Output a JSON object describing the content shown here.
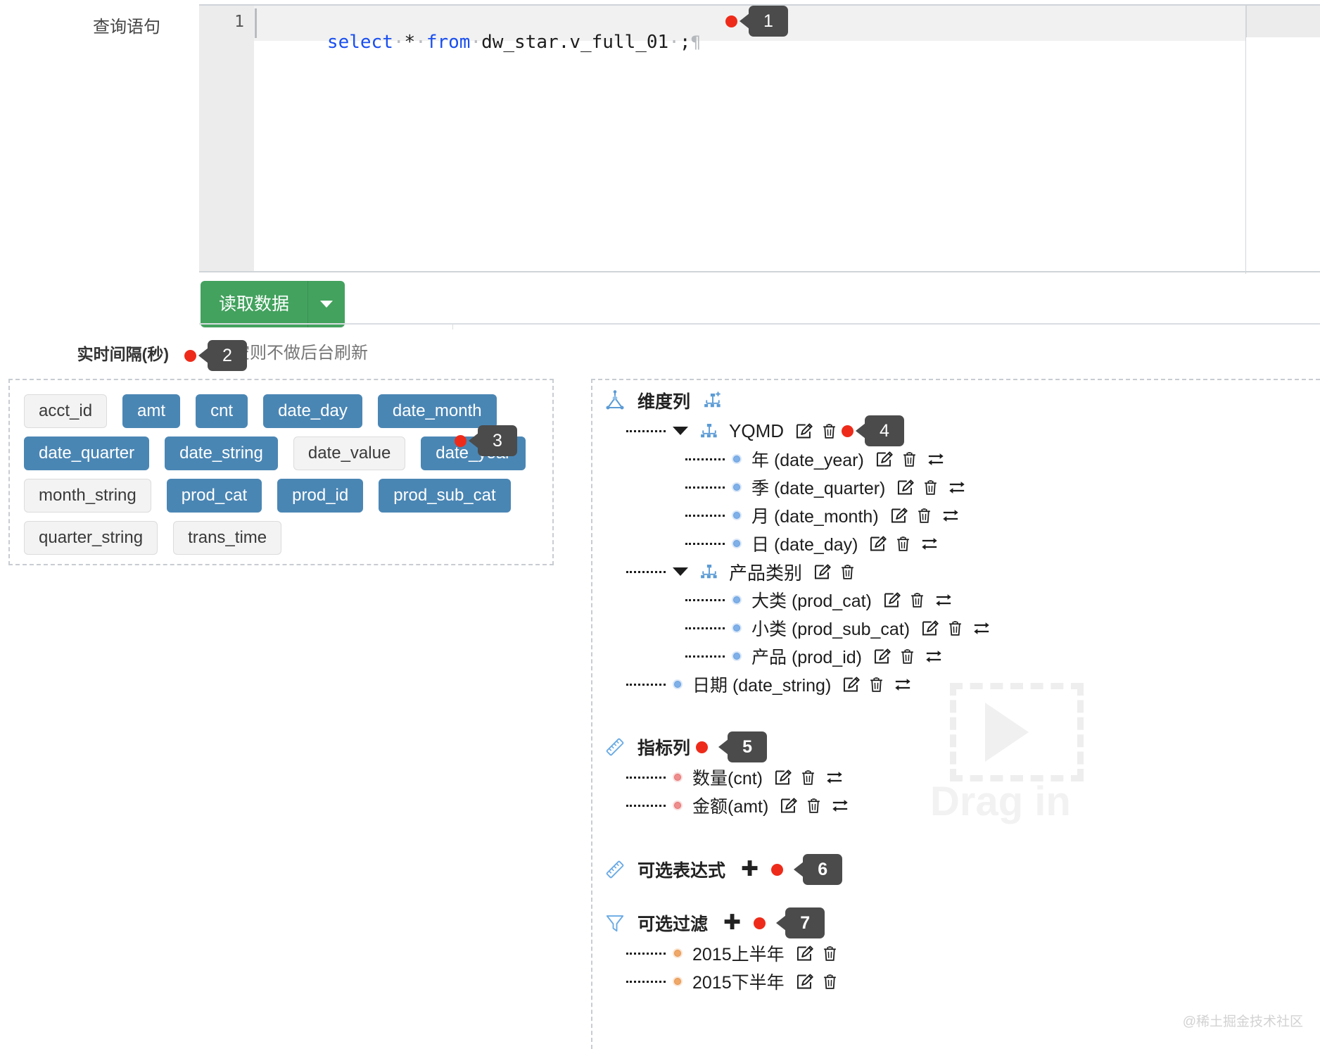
{
  "query": {
    "label": "查询语句",
    "line_number": "1",
    "sql_tokens": [
      {
        "t": "select",
        "k": "kw"
      },
      {
        "t": "·",
        "k": "sep"
      },
      {
        "t": "*",
        "k": "plain"
      },
      {
        "t": "·",
        "k": "sep"
      },
      {
        "t": "from",
        "k": "kw"
      },
      {
        "t": "·",
        "k": "sep"
      },
      {
        "t": "dw_star.v_full_01",
        "k": "plain"
      },
      {
        "t": "·",
        "k": "sep"
      },
      {
        "t": ";",
        "k": "plain"
      }
    ],
    "sql_text": "select * from dw_star.v_full_01 ;",
    "pilcrow": "¶",
    "callout": "1"
  },
  "actions": {
    "read_data_label": "读取数据",
    "dropdown_icon": "chevron-down-icon"
  },
  "realtime": {
    "label": "实时间隔(秒)",
    "placeholder": "留空则不做后台刷新",
    "value": "",
    "callout": "2"
  },
  "fields": {
    "callout": "3",
    "items": [
      {
        "name": "acct_id",
        "used": false
      },
      {
        "name": "amt",
        "used": true
      },
      {
        "name": "cnt",
        "used": true
      },
      {
        "name": "date_day",
        "used": true
      },
      {
        "name": "date_month",
        "used": true
      },
      {
        "name": "date_quarter",
        "used": true
      },
      {
        "name": "date_string",
        "used": true
      },
      {
        "name": "date_value",
        "used": false
      },
      {
        "name": "date_year",
        "used": true
      },
      {
        "name": "month_string",
        "used": false
      },
      {
        "name": "prod_cat",
        "used": true
      },
      {
        "name": "prod_id",
        "used": true
      },
      {
        "name": "prod_sub_cat",
        "used": true
      },
      {
        "name": "quarter_string",
        "used": false
      },
      {
        "name": "trans_time",
        "used": false
      }
    ]
  },
  "dimensions": {
    "title": "维度列",
    "icon": "dimension-icon",
    "add_icon": "add-hierarchy-icon",
    "groups": [
      {
        "name": "YQMD",
        "callout": "4",
        "icon": "hierarchy-icon",
        "actions": [
          "edit-icon",
          "trash-icon"
        ],
        "children": [
          {
            "label": "年 (date_year)",
            "actions": [
              "edit-icon",
              "trash-icon",
              "swap-icon"
            ]
          },
          {
            "label": "季 (date_quarter)",
            "actions": [
              "edit-icon",
              "trash-icon",
              "swap-icon"
            ]
          },
          {
            "label": "月 (date_month)",
            "actions": [
              "edit-icon",
              "trash-icon",
              "swap-icon"
            ]
          },
          {
            "label": "日 (date_day)",
            "actions": [
              "edit-icon",
              "trash-icon",
              "swap-icon"
            ]
          }
        ]
      },
      {
        "name": "产品类别",
        "callout": "",
        "icon": "hierarchy-icon",
        "actions": [
          "edit-icon",
          "trash-icon"
        ],
        "children": [
          {
            "label": "大类 (prod_cat)",
            "actions": [
              "edit-icon",
              "trash-icon",
              "swap-icon"
            ]
          },
          {
            "label": "小类 (prod_sub_cat)",
            "actions": [
              "edit-icon",
              "trash-icon",
              "swap-icon"
            ]
          },
          {
            "label": "产品 (prod_id)",
            "actions": [
              "edit-icon",
              "trash-icon",
              "swap-icon"
            ]
          }
        ]
      }
    ],
    "leaves": [
      {
        "label": "日期 (date_string)",
        "actions": [
          "edit-icon",
          "trash-icon",
          "swap-icon"
        ]
      }
    ]
  },
  "metrics": {
    "title": "指标列",
    "icon": "ruler-icon",
    "callout": "5",
    "items": [
      {
        "label": "数量(cnt)",
        "actions": [
          "edit-icon",
          "trash-icon",
          "swap-icon"
        ]
      },
      {
        "label": "金额(amt)",
        "actions": [
          "edit-icon",
          "trash-icon",
          "swap-icon"
        ]
      }
    ]
  },
  "expressions": {
    "title": "可选表达式",
    "icon": "ruler-icon",
    "add_icon": "plus-icon",
    "callout": "6",
    "items": []
  },
  "filters": {
    "title": "可选过滤",
    "icon": "funnel-icon",
    "add_icon": "plus-icon",
    "callout": "7",
    "items": [
      {
        "label": "2015上半年",
        "actions": [
          "edit-icon",
          "trash-icon"
        ]
      },
      {
        "label": "2015下半年",
        "actions": [
          "edit-icon",
          "trash-icon"
        ]
      }
    ]
  },
  "watermarks": {
    "drag_in": "Drag in",
    "corner": "@稀土掘金技术社区"
  },
  "colors": {
    "tag_used_bg": "#4a86b4",
    "tag_unused_bg": "#f3f3f3",
    "button_green": "#43a25e",
    "callout_dark": "#4b4b4b",
    "attention_red": "#ee2b1a",
    "keyword_blue": "#1a4ff0"
  }
}
